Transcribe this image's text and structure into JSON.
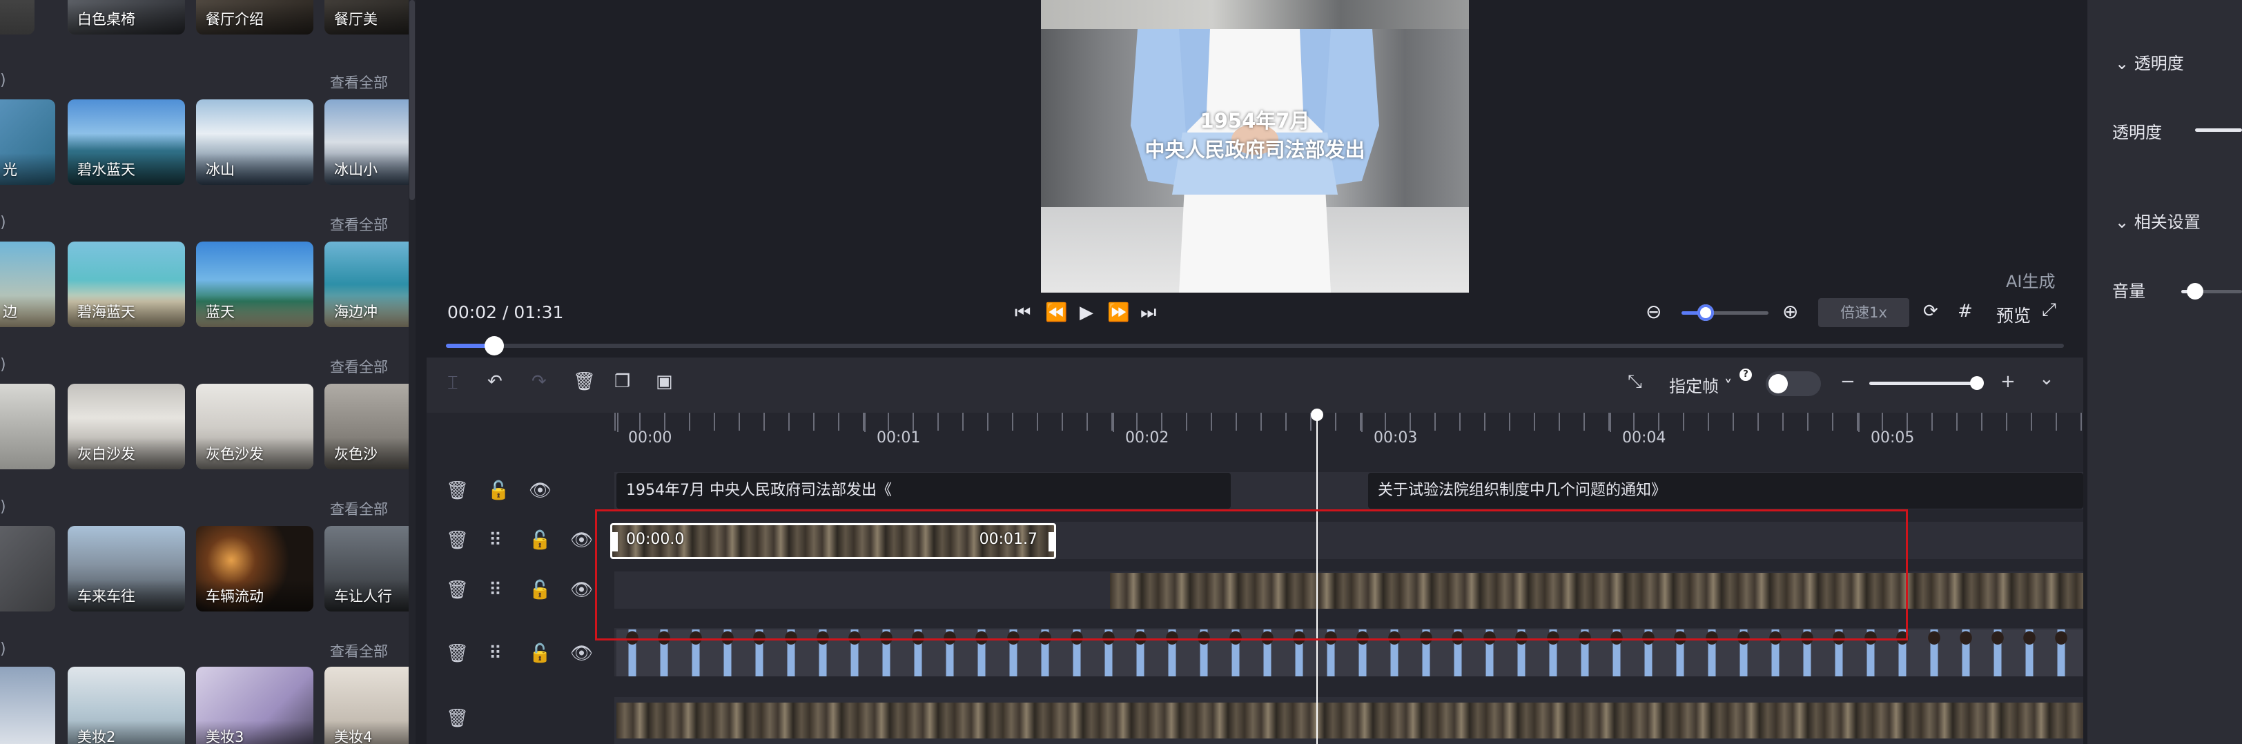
{
  "materials": {
    "top_labels": [
      "白色桌椅",
      "餐厅介绍",
      "餐厅美"
    ],
    "sections": [
      {
        "prefix": ")",
        "see_all": "查看全部",
        "items": [
          "光",
          "碧水蓝天",
          "冰山",
          "冰山小"
        ]
      },
      {
        "prefix": ")",
        "see_all": "查看全部",
        "items": [
          "边",
          "碧海蓝天",
          "蓝天",
          "海边冲"
        ]
      },
      {
        "prefix": ")",
        "see_all": "查看全部",
        "items": [
          "",
          "灰白沙发",
          "灰色沙发",
          "灰色沙"
        ]
      },
      {
        "prefix": ")",
        "see_all": "查看全部",
        "items": [
          "",
          "车来车往",
          "车辆流动",
          "车让人行"
        ]
      },
      {
        "prefix": ")",
        "see_all": "查看全部",
        "items": [
          "",
          "美妆2",
          "美妆3",
          "美妆4"
        ]
      }
    ]
  },
  "preview": {
    "subtitle_line1": "1954年7月",
    "subtitle_line2": "中央人民政府司法部发出",
    "time_current": "00:02",
    "time_separator": " / ",
    "time_total": "01:31",
    "ai_badge": "AI生成",
    "speed_placeholder": "倍速1x",
    "preview_label": "预览",
    "progress_fraction": 0.03,
    "zoom_fraction": 0.28
  },
  "timeline": {
    "frame_label": "指定帧",
    "help_mark": "?",
    "ruler": [
      "00:00",
      "00:01",
      "00:02",
      "00:03",
      "00:04",
      "00:05"
    ],
    "text_clips": [
      "1954年7月 中央人民政府司法部发出《",
      "关于试验法院组织制度中几个问题的通知》"
    ],
    "selected_clip": {
      "start": "00:00.0",
      "end": "00:01.7"
    }
  },
  "properties": {
    "opacity_section": "透明度",
    "opacity_label": "透明度",
    "related_section": "相关设置",
    "volume_label": "音量"
  },
  "colors": {
    "accent": "#5b7cf7",
    "selection": "#d0141b",
    "panel": "#2a2b33"
  }
}
